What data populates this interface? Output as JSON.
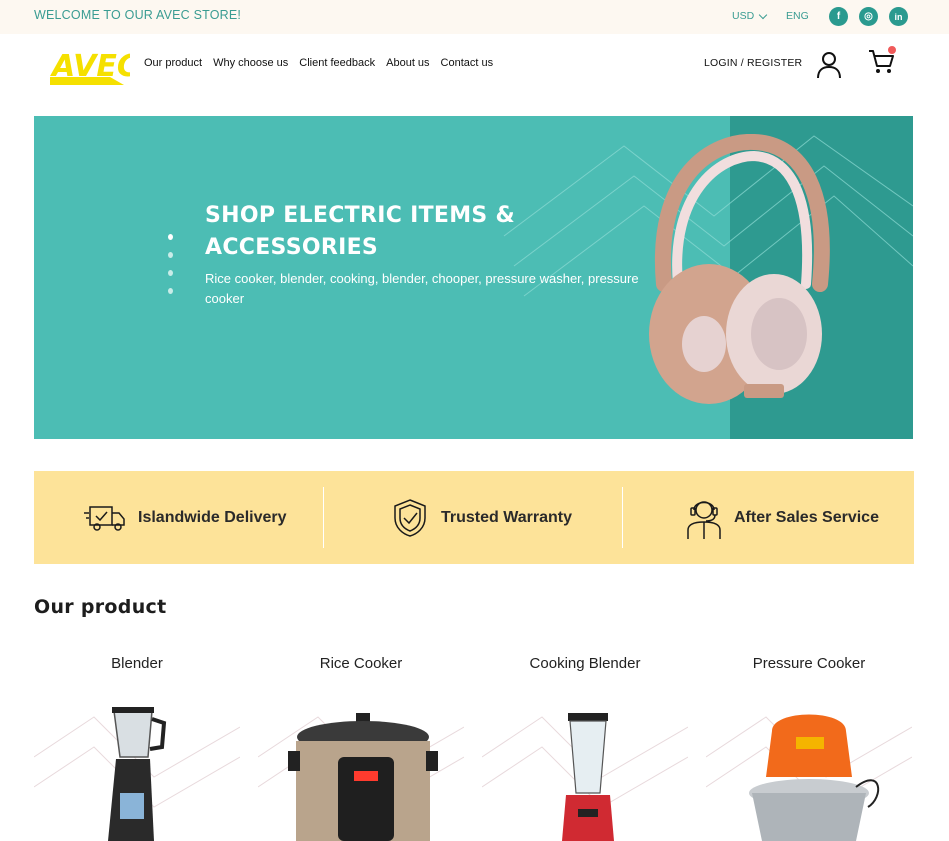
{
  "topbar": {
    "welcome": "WELCOME TO OUR AVEC STORE!",
    "currency": "USD",
    "language": "ENG",
    "social": [
      {
        "icon": "facebook-icon",
        "glyph": "f"
      },
      {
        "icon": "instagram-icon",
        "glyph": "◎"
      },
      {
        "icon": "linkedin-icon",
        "glyph": "in"
      }
    ]
  },
  "header": {
    "logo_text": "AVEC",
    "nav": [
      "Our product",
      "Why choose us",
      "Client feedback",
      "About us",
      "Contact us"
    ],
    "login": "LOGIN / REGISTER"
  },
  "hero": {
    "title": "SHOP ELECTRIC ITEMS & ACCESSORIES",
    "subtitle": "Rice cooker, blender, cooking, blender, chooper, pressure washer, pressure cooker",
    "slide_count": 4,
    "active_slide": 1
  },
  "features": [
    {
      "label": "Islandwide Delivery",
      "icon": "delivery-truck-icon"
    },
    {
      "label": "Trusted Warranty",
      "icon": "warranty-shield-icon"
    },
    {
      "label": "After Sales Service",
      "icon": "support-agent-icon"
    }
  ],
  "products_section": {
    "title": "Our product",
    "items": [
      {
        "name": "Blender",
        "icon": "blender-image"
      },
      {
        "name": "Rice Cooker",
        "icon": "rice-cooker-image"
      },
      {
        "name": "Cooking Blender",
        "icon": "cooking-blender-image"
      },
      {
        "name": "Pressure Cooker",
        "icon": "pressure-cooker-image"
      }
    ]
  },
  "colors": {
    "teal": "#4cbdb4",
    "teal_dark": "#2e9a90",
    "brand_yellow": "#f5e000",
    "feature_bg": "#fde399",
    "topbar_bg": "#fdf8f1"
  }
}
